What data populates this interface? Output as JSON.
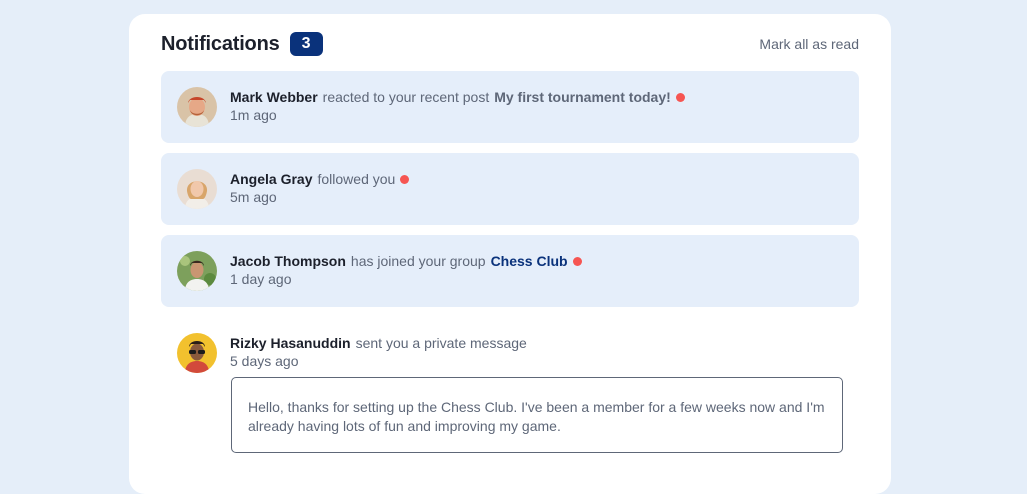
{
  "header": {
    "title": "Notifications",
    "unread_count": "3",
    "mark_all_label": "Mark all as read"
  },
  "notifications": [
    {
      "user": "Mark Webber",
      "action": "reacted to your recent post",
      "target": "My first tournament today!",
      "time": "1m ago",
      "unread": true
    },
    {
      "user": "Angela Gray",
      "action": "followed you",
      "time": "5m ago",
      "unread": true
    },
    {
      "user": "Jacob Thompson",
      "action": "has joined your group",
      "target": "Chess Club",
      "time": "1 day ago",
      "unread": true
    },
    {
      "user": "Rizky Hasanuddin",
      "action": "sent you a private message",
      "time": "5 days ago",
      "unread": false,
      "message": "Hello, thanks for setting up the Chess Club. I've been a member for a few weeks now and I'm already having lots of fun and improving my game."
    }
  ],
  "colors": {
    "page_bg": "#e5eef9",
    "unread_bg": "#e5eefa",
    "badge": "#0a327b",
    "unread_dot": "#f65552",
    "group_link": "#0a327b"
  }
}
